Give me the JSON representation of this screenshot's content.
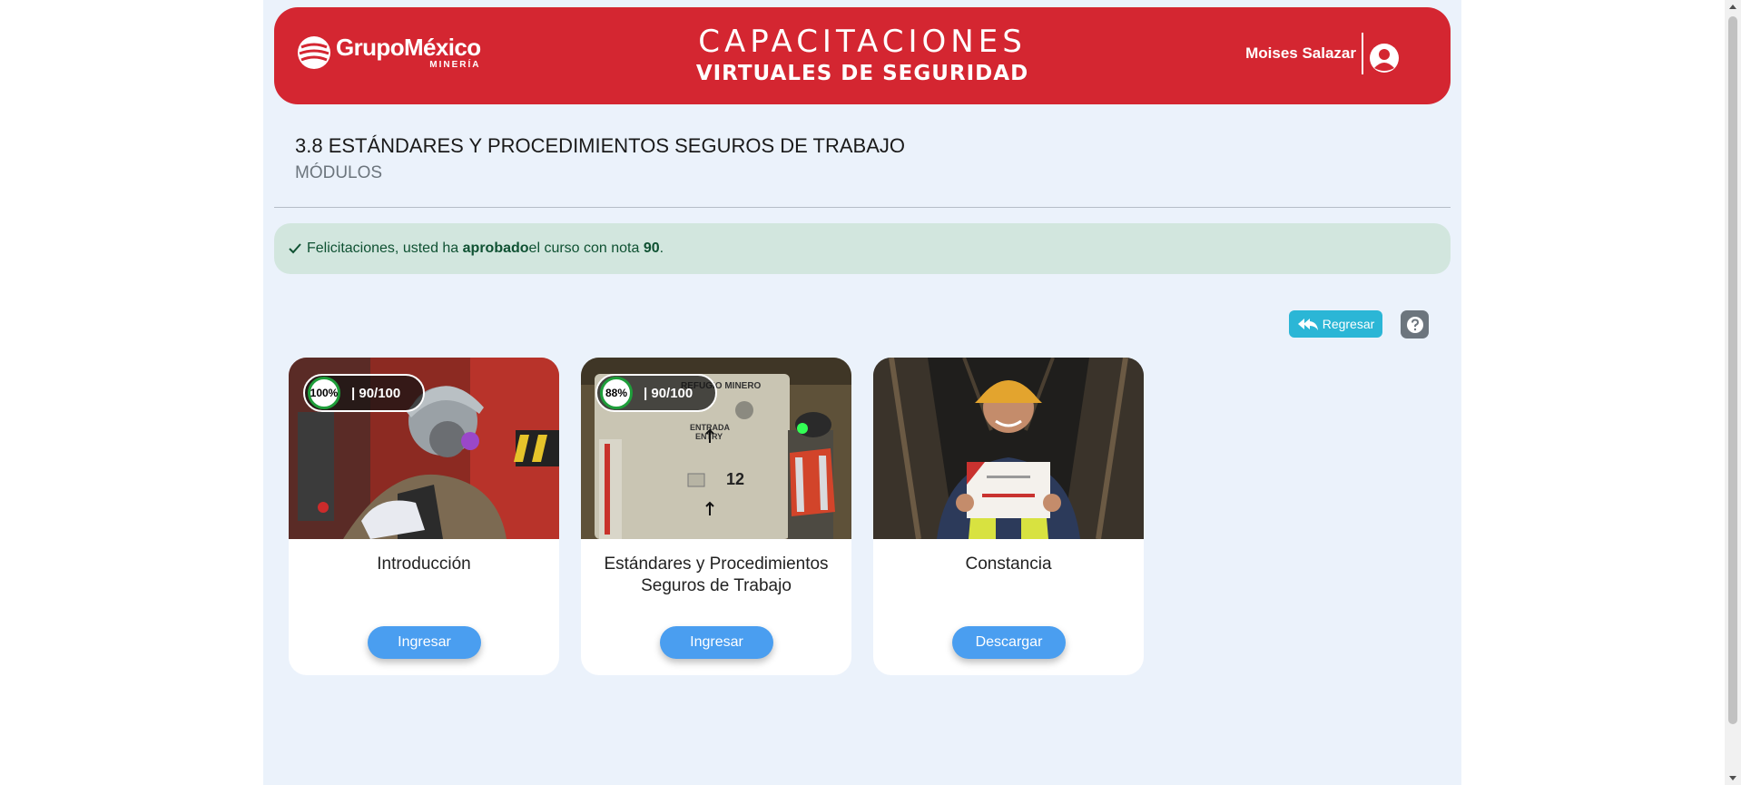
{
  "header": {
    "logo_name": "GrupoMéxico",
    "logo_sub": "MINERÍA",
    "title_line1": "CAPACITACIONES",
    "title_line2": "VIRTUALES DE SEGURIDAD",
    "user_name": "Moises Salazar",
    "colors": {
      "brand_red": "#d42631"
    }
  },
  "course": {
    "title": "3.8 ESTÁNDARES Y PROCEDIMIENTOS SEGUROS DE TRABAJO",
    "subtitle": "MÓDULOS"
  },
  "alert": {
    "prefix": "Felicitaciones, usted ha ",
    "bold1": "aprobado",
    "middle": " el curso con nota ",
    "bold2": "90",
    "suffix": ".",
    "icon": "check-icon"
  },
  "actions": {
    "back_label": "Regresar",
    "back_icon": "reply-all-icon",
    "help_icon": "question-circle-icon"
  },
  "modules": [
    {
      "title": "Introducción",
      "progress": "100%",
      "score": "| 90/100",
      "button": "Ingresar"
    },
    {
      "title": "Estándares y Procedimientos Seguros de Trabajo",
      "progress": "88%",
      "score": "| 90/100",
      "button": "Ingresar"
    },
    {
      "title": "Constancia",
      "button": "Descargar"
    }
  ],
  "scene_text": {
    "sign1": "REFUGIO MINERO",
    "sign2": "ENTRADA",
    "sign3": "ENTRY",
    "sign4": "12"
  }
}
